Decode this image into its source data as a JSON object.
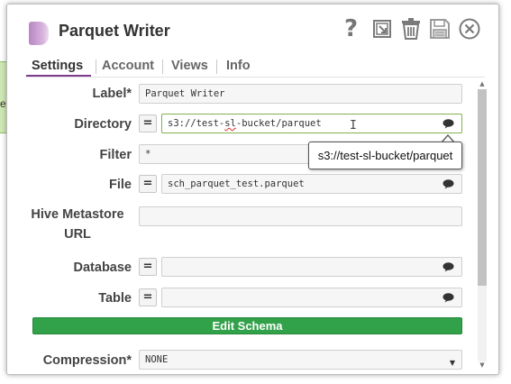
{
  "background": {
    "snap_edge_text": "ea"
  },
  "dialog": {
    "title": "Parquet Writer",
    "header_icons": [
      "help-icon",
      "export-icon",
      "trash-icon",
      "save-icon",
      "close-icon"
    ],
    "help_glyph": "?",
    "tabs": [
      {
        "label": "Settings",
        "active": true
      },
      {
        "label": "Account",
        "active": false
      },
      {
        "label": "Views",
        "active": false
      },
      {
        "label": "Info",
        "active": false
      }
    ],
    "eq_glyph": "=",
    "fields": {
      "label": {
        "label": "Label*",
        "value": "Parquet Writer"
      },
      "directory": {
        "label": "Directory",
        "value_prefix": "s3://test-",
        "value_squiggle": "sl",
        "value_suffix": "-bucket/parquet"
      },
      "filter": {
        "label": "Filter",
        "value": "*"
      },
      "file": {
        "label": "File",
        "value": "sch_parquet_test.parquet"
      },
      "hive_metastore_url": {
        "label": "Hive Metastore URL",
        "value": ""
      },
      "database": {
        "label": "Database",
        "value": ""
      },
      "table": {
        "label": "Table",
        "value": ""
      },
      "compression": {
        "label": "Compression*",
        "value": "NONE"
      }
    },
    "tooltip": "s3://test-sl-bucket/parquet",
    "edit_schema_label": "Edit Schema",
    "colors": {
      "accent_purple": "#7d3d8c",
      "button_green": "#31a14a",
      "focus_green": "#82b14c"
    }
  }
}
